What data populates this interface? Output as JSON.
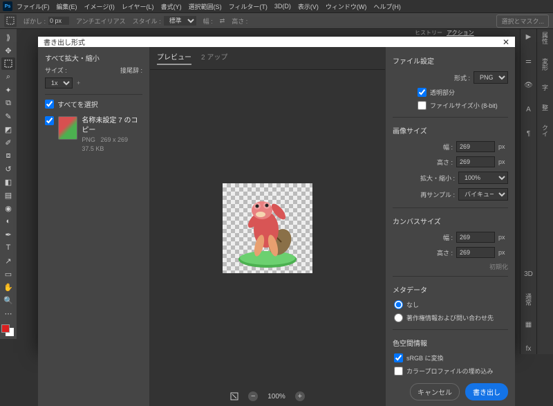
{
  "menu": {
    "items": [
      "ファイル(F)",
      "編集(E)",
      "イメージ(I)",
      "レイヤー(L)",
      "書式(Y)",
      "選択範囲(S)",
      "フィルター(T)",
      "3D(D)",
      "表示(V)",
      "ウィンドウ(W)",
      "ヘルプ(H)"
    ]
  },
  "optbar": {
    "feather_label": "ぼかし :",
    "feather_value": "0 px",
    "antialias": "アンチエイリアス",
    "style_label": "スタイル :",
    "style_value": "標準",
    "width_label": "幅 :",
    "height_label": "高さ :",
    "mask_btn": "選択とマスク..."
  },
  "history_tabs": {
    "history": "ヒストリー",
    "actions": "アクション"
  },
  "right_panel_labels": {
    "props": "属性",
    "variant": "変形",
    "chars": "字",
    "layer_comp": "整",
    "quick": "クイ"
  },
  "dialog": {
    "title": "書き出し形式",
    "left": {
      "scale_title": "すべて拡大・縮小",
      "size_label": "サイズ :",
      "suffix_label": "接尾辞 :",
      "size_value": "1x",
      "select_all": "すべてを選択",
      "asset": {
        "name": "名称未設定 7 のコピー",
        "format": "PNG",
        "dims": "269 x 269",
        "size": "37.5 KB"
      }
    },
    "tabs": {
      "preview": "プレビュー",
      "two_up": "2 アップ"
    },
    "zoom": "100%",
    "right": {
      "file_section": "ファイル設定",
      "format_label": "形式 :",
      "format_value": "PNG",
      "transparency": "透明部分",
      "small_file": "ファイルサイズ小 (8-bit)",
      "image_size_section": "画像サイズ",
      "width_label": "幅 :",
      "height_label": "高さ :",
      "width_value": "269",
      "height_value": "269",
      "px": "px",
      "scale_label": "拡大・縮小 :",
      "scale_value": "100%",
      "resample_label": "再サンプル :",
      "resample_value": "バイキュービック...",
      "canvas_section": "カンバスサイズ",
      "canvas_w": "269",
      "canvas_h": "269",
      "reset": "初期化",
      "metadata_section": "メタデータ",
      "meta_none": "なし",
      "meta_copyright": "著作権情報および問い合わせ先",
      "colorspace_section": "色空間情報",
      "srgb": "sRGB に変換",
      "embed_profile": "カラープロファイルの埋め込み",
      "cancel": "キャンセル",
      "export": "書き出し"
    }
  }
}
